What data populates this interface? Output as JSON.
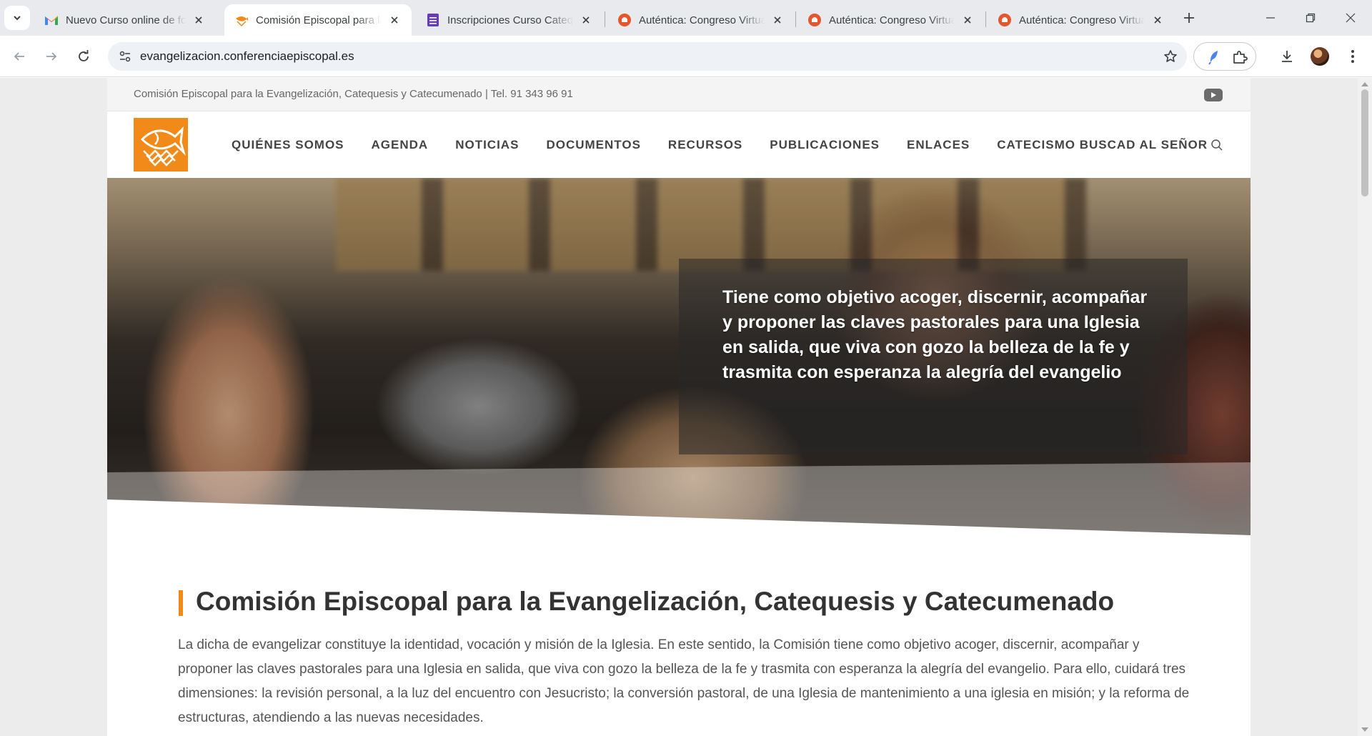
{
  "browser": {
    "tabs": [
      {
        "title": "Nuevo Curso online de formación",
        "favicon": "gmail-icon",
        "active": false
      },
      {
        "title": "Comisión Episcopal para la Evangelización",
        "favicon": "fish-logo-icon",
        "active": true
      },
      {
        "title": "Inscripciones Curso Catequistas",
        "favicon": "forms-icon",
        "active": false
      },
      {
        "title": "Auténtica: Congreso Virtual",
        "favicon": "autentica-icon",
        "active": false
      },
      {
        "title": "Auténtica: Congreso Virtual",
        "favicon": "autentica-icon",
        "active": false
      },
      {
        "title": "Auténtica: Congreso Virtual",
        "favicon": "autentica-icon",
        "active": false
      }
    ],
    "url": "evangelizacion.conferenciaepiscopal.es"
  },
  "site": {
    "topbar_info": "Comisión Episcopal para la Evangelización, Catequesis y Catecumenado | Tel. 91 343 96 91",
    "menu": [
      "QUIÉNES SOMOS",
      "AGENDA",
      "NOTICIAS",
      "DOCUMENTOS",
      "RECURSOS",
      "PUBLICACIONES",
      "ENLACES",
      "CATECISMO BUSCAD AL SEÑOR"
    ],
    "hero_text": "Tiene como objetivo acoger, discernir, acompañar y proponer las claves pastorales para una Iglesia en salida, que viva con gozo la belleza de la fe y trasmita con esperanza la alegría del evangelio",
    "title": "Comisión Episcopal para la Evangelización, Catequesis y Catecumenado",
    "intro": "La dicha de evangelizar constituye la identidad, vocación y misión de la Iglesia. En este sentido, la Comisión tiene como objetivo acoger, discernir, acompañar y proponer las claves pastorales para una Iglesia en salida, que viva con gozo la belleza de la fe y trasmita con esperanza la alegría del evangelio. Para ello, cuidará tres dimensiones: la revisión personal, a la luz del encuentro con Jesucristo; la conversión pastoral, de una Iglesia de mantenimiento a una iglesia en misión; y la reforma de estructuras, atendiendo a las nuevas necesidades."
  },
  "colors": {
    "accent": "#f28a1a",
    "chrome": "#e8eaed",
    "nav_text": "#444444"
  }
}
